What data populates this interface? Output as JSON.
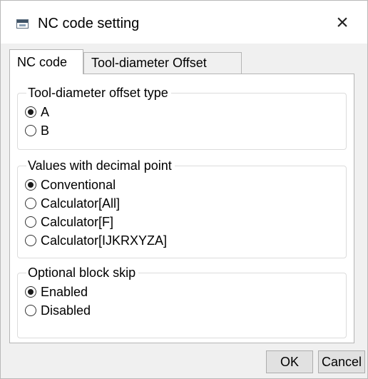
{
  "window": {
    "title": "NC code setting",
    "close_symbol": "×"
  },
  "tabs": [
    {
      "label": "NC code",
      "active": true
    },
    {
      "label": "Tool-diameter Offset",
      "active": false
    }
  ],
  "groups": {
    "offset_type": {
      "legend": "Tool-diameter offset type",
      "options": [
        {
          "label": "A",
          "checked": true
        },
        {
          "label": "B",
          "checked": false
        }
      ]
    },
    "decimal": {
      "legend": "Values with decimal point",
      "options": [
        {
          "label": "Conventional",
          "checked": true
        },
        {
          "label": "Calculator[All]",
          "checked": false
        },
        {
          "label": "Calculator[F]",
          "checked": false
        },
        {
          "label": "Calculator[IJKRXYZA]",
          "checked": false
        }
      ]
    },
    "block_skip": {
      "legend": "Optional block skip",
      "options": [
        {
          "label": "Enabled",
          "checked": true
        },
        {
          "label": "Disabled",
          "checked": false
        }
      ]
    }
  },
  "buttons": {
    "ok": "OK",
    "cancel": "Cancel"
  }
}
